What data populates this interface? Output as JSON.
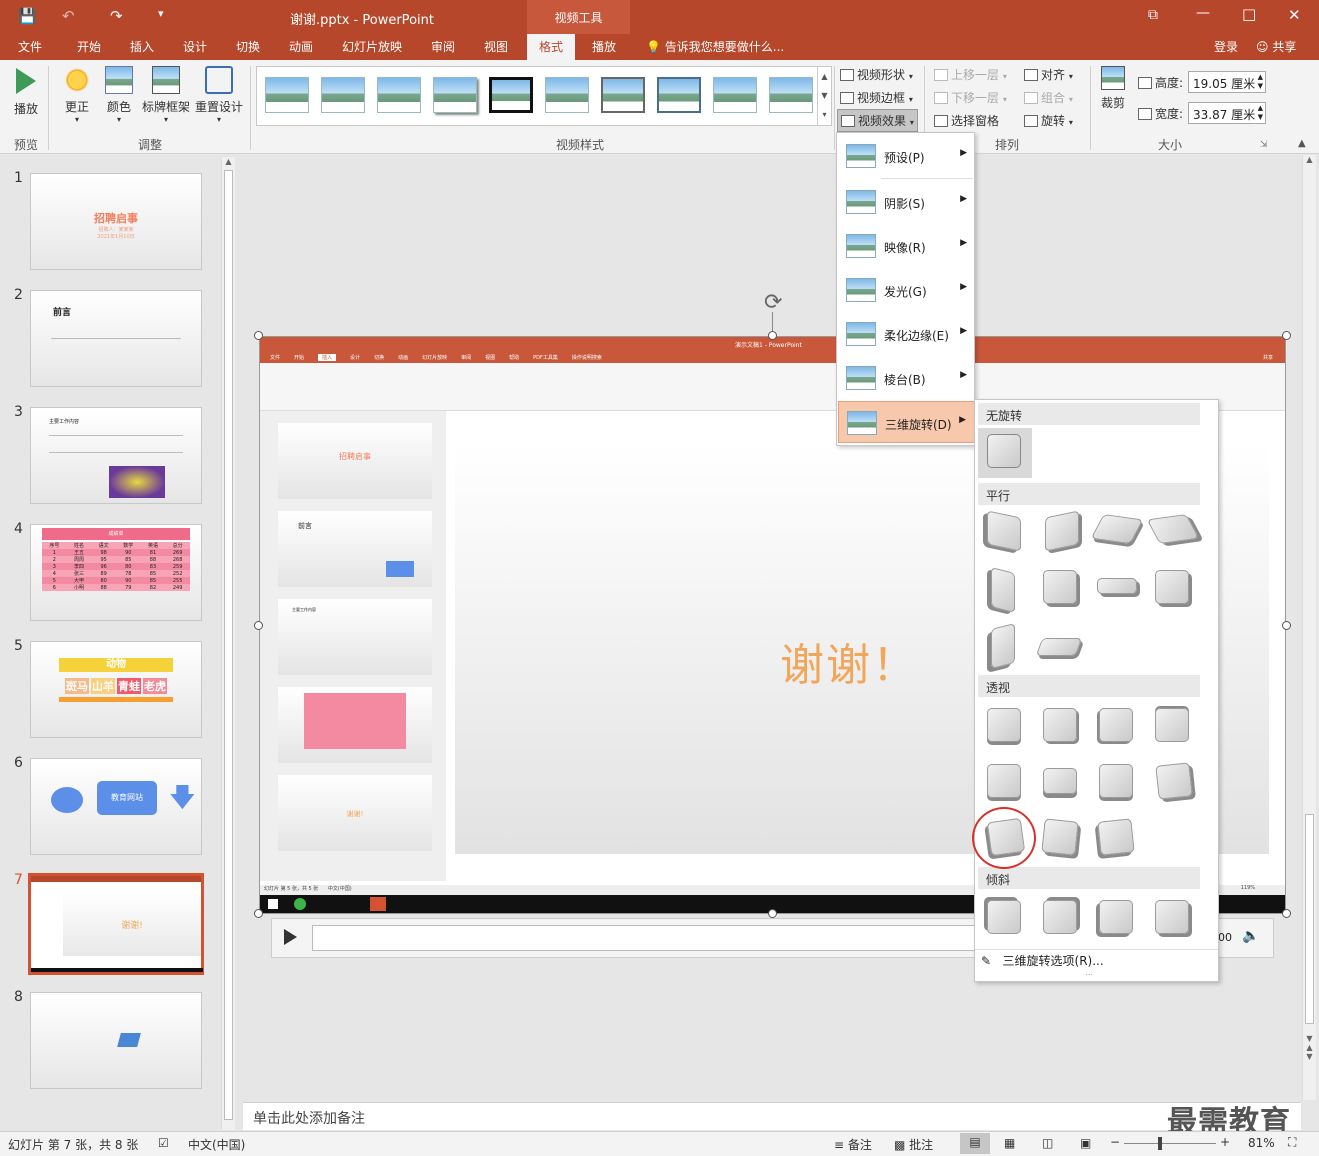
{
  "window": {
    "title": "谢谢.pptx - PowerPoint",
    "context_tab_group": "视频工具"
  },
  "qat": {
    "save_icon": "save-icon",
    "undo_icon": "undo-icon",
    "redo_icon": "redo-icon",
    "customize_icon": "customize-icon"
  },
  "title_controls": {
    "ribbon_display": "⧉",
    "minimize": "—",
    "maximize": "□",
    "close": "✕"
  },
  "tabs": [
    "文件",
    "开始",
    "插入",
    "设计",
    "切换",
    "动画",
    "幻灯片放映",
    "审阅",
    "视图",
    "格式",
    "播放"
  ],
  "active_tab": "格式",
  "tell_me": "告诉我您想要做什么...",
  "account": {
    "login": "登录",
    "share": "共享"
  },
  "ribbon": {
    "play": "播放",
    "correct": "更正",
    "color": "颜色",
    "poster_frame": "标牌框架",
    "reset_design": "重置设计",
    "groups": {
      "preview": "预览",
      "adjust": "调整",
      "video_styles": "视频样式",
      "arrange": "排列",
      "size": "大小"
    },
    "video_shape": "视频形状",
    "video_border": "视频边框",
    "video_effects": "视频效果",
    "bring_forward": "上移一层",
    "send_backward": "下移一层",
    "selection_pane": "选择窗格",
    "align": "对齐",
    "group": "组合",
    "rotate": "旋转",
    "crop": "裁剪",
    "height_label": "高度:",
    "height_value": "19.05 厘米",
    "width_label": "宽度:",
    "width_value": "33.87 厘米"
  },
  "effects_menu": [
    {
      "label": "预设(P)",
      "icon": "preset-icon"
    },
    {
      "label": "阴影(S)",
      "icon": "shadow-icon"
    },
    {
      "label": "映像(R)",
      "icon": "reflection-icon"
    },
    {
      "label": "发光(G)",
      "icon": "glow-icon"
    },
    {
      "label": "柔化边缘(E)",
      "icon": "soft-edges-icon"
    },
    {
      "label": "棱台(B)",
      "icon": "bevel-icon"
    },
    {
      "label": "三维旋转(D)",
      "icon": "3d-rotation-icon"
    }
  ],
  "rotation_gallery": {
    "sections": [
      "无旋转",
      "平行",
      "透视",
      "倾斜"
    ],
    "options_link": "三维旋转选项(R)..."
  },
  "slides": [
    {
      "num": "1",
      "title": "招聘启事",
      "sub": "招聘人：某某某",
      "date": "2021年1月10日"
    },
    {
      "num": "2",
      "title": "前言"
    },
    {
      "num": "3",
      "title": "主要工作内容"
    },
    {
      "num": "4",
      "title": "成绩单",
      "headers": [
        "序号",
        "姓名",
        "语文",
        "数学",
        "英语",
        "总分"
      ],
      "rows": [
        [
          "1",
          "王五",
          "98",
          "90",
          "81",
          "269"
        ],
        [
          "2",
          "周周",
          "95",
          "85",
          "88",
          "268"
        ],
        [
          "3",
          "李四",
          "96",
          "80",
          "83",
          "259"
        ],
        [
          "4",
          "张三",
          "89",
          "78",
          "85",
          "252"
        ],
        [
          "5",
          "大甲",
          "80",
          "90",
          "85",
          "255"
        ],
        [
          "6",
          "小明",
          "88",
          "79",
          "82",
          "249"
        ]
      ]
    },
    {
      "num": "5",
      "title": "动物",
      "animals": [
        "斑马",
        "山羊",
        "青蛙",
        "老虎"
      ]
    },
    {
      "num": "6",
      "label": "教育网站"
    },
    {
      "num": "7",
      "text": "谢谢!"
    },
    {
      "num": "8"
    }
  ],
  "video": {
    "thank_you": "谢谢！",
    "inner_title": "演示文稿1 - PowerPoint",
    "inner_tabs": [
      "文件",
      "开始",
      "插入",
      "设计",
      "切换",
      "动画",
      "幻灯片放映",
      "审阅",
      "视图",
      "帮助",
      "PDF工具集",
      "操作说明搜索"
    ],
    "inner_share": "共享",
    "inner_slides": [
      {
        "num": "1",
        "title": "招聘启事",
        "sub": "招聘人：某某某"
      },
      {
        "num": "2",
        "title": "前言"
      },
      {
        "num": "3",
        "title": "主要工作内容"
      },
      {
        "num": "4"
      },
      {
        "num": "5",
        "text": "谢谢!"
      }
    ],
    "inner_status": "幻灯片 第 5 张，共 5 张",
    "inner_lang": "中文(中国)",
    "inner_zoom": "119%",
    "player_time": "00"
  },
  "notes_placeholder": "单击此处添加备注",
  "status": {
    "slide_info": "幻灯片 第 7 张，共 8 张",
    "language": "中文(中国)",
    "notes": "备注",
    "comments": "批注",
    "zoom": "81%",
    "zoom_minus": "−",
    "zoom_plus": "+"
  },
  "watermark": "最需教育",
  "colors": {
    "accent": "#b7472a",
    "highlight": "#f8c8ad",
    "circle": "#d9312a",
    "thank_you": "#f2a65a"
  }
}
